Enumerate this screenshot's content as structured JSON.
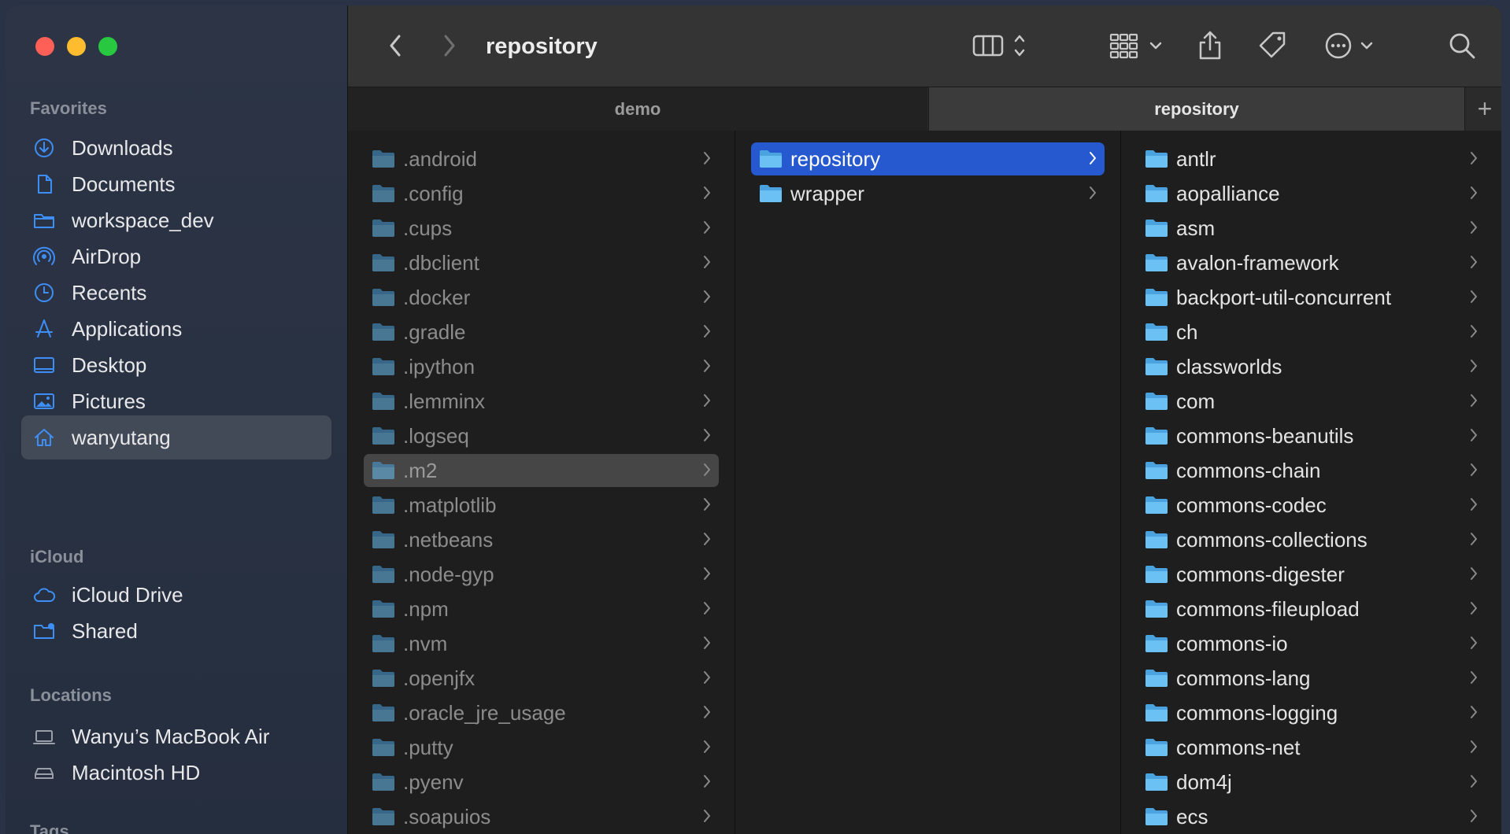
{
  "window": {
    "title": "repository"
  },
  "colors": {
    "accent": "#2658cf",
    "folder": "#5fb5ef",
    "sidebar_icon": "#3d8ef7"
  },
  "sidebar": {
    "favorites_header": "Favorites",
    "favorites": [
      {
        "label": "Downloads",
        "icon": "download-circle-icon"
      },
      {
        "label": "Documents",
        "icon": "document-icon"
      },
      {
        "label": "workspace_dev",
        "icon": "folder-icon"
      },
      {
        "label": "AirDrop",
        "icon": "airdrop-icon"
      },
      {
        "label": "Recents",
        "icon": "clock-icon"
      },
      {
        "label": "Applications",
        "icon": "applications-icon"
      },
      {
        "label": "Desktop",
        "icon": "desktop-icon"
      },
      {
        "label": "Pictures",
        "icon": "photo-icon"
      },
      {
        "label": "wanyutang",
        "icon": "home-icon",
        "selected": true
      }
    ],
    "icloud_header": "iCloud",
    "icloud": [
      {
        "label": "iCloud Drive",
        "icon": "cloud-icon"
      },
      {
        "label": "Shared",
        "icon": "shared-folder-icon"
      }
    ],
    "locations_header": "Locations",
    "locations": [
      {
        "label": "Wanyu’s MacBook Air",
        "icon": "laptop-icon"
      },
      {
        "label": "Macintosh HD",
        "icon": "disk-icon"
      }
    ],
    "tags_header": "Tags"
  },
  "tabs": {
    "inactive": "demo",
    "active": "repository",
    "add": "+"
  },
  "columns": {
    "col1": [
      ".android",
      ".config",
      ".cups",
      ".dbclient",
      ".docker",
      ".gradle",
      ".ipython",
      ".lemminx",
      ".logseq",
      ".m2",
      ".matplotlib",
      ".netbeans",
      ".node-gyp",
      ".npm",
      ".nvm",
      ".openjfx",
      ".oracle_jre_usage",
      ".putty",
      ".pyenv",
      ".soapuios"
    ],
    "col1_selected": ".m2",
    "col2": [
      "repository",
      "wrapper"
    ],
    "col2_selected": "repository",
    "col3": [
      "antlr",
      "aopalliance",
      "asm",
      "avalon-framework",
      "backport-util-concurrent",
      "ch",
      "classworlds",
      "com",
      "commons-beanutils",
      "commons-chain",
      "commons-codec",
      "commons-collections",
      "commons-digester",
      "commons-fileupload",
      "commons-io",
      "commons-lang",
      "commons-logging",
      "commons-net",
      "dom4j",
      "ecs"
    ]
  }
}
